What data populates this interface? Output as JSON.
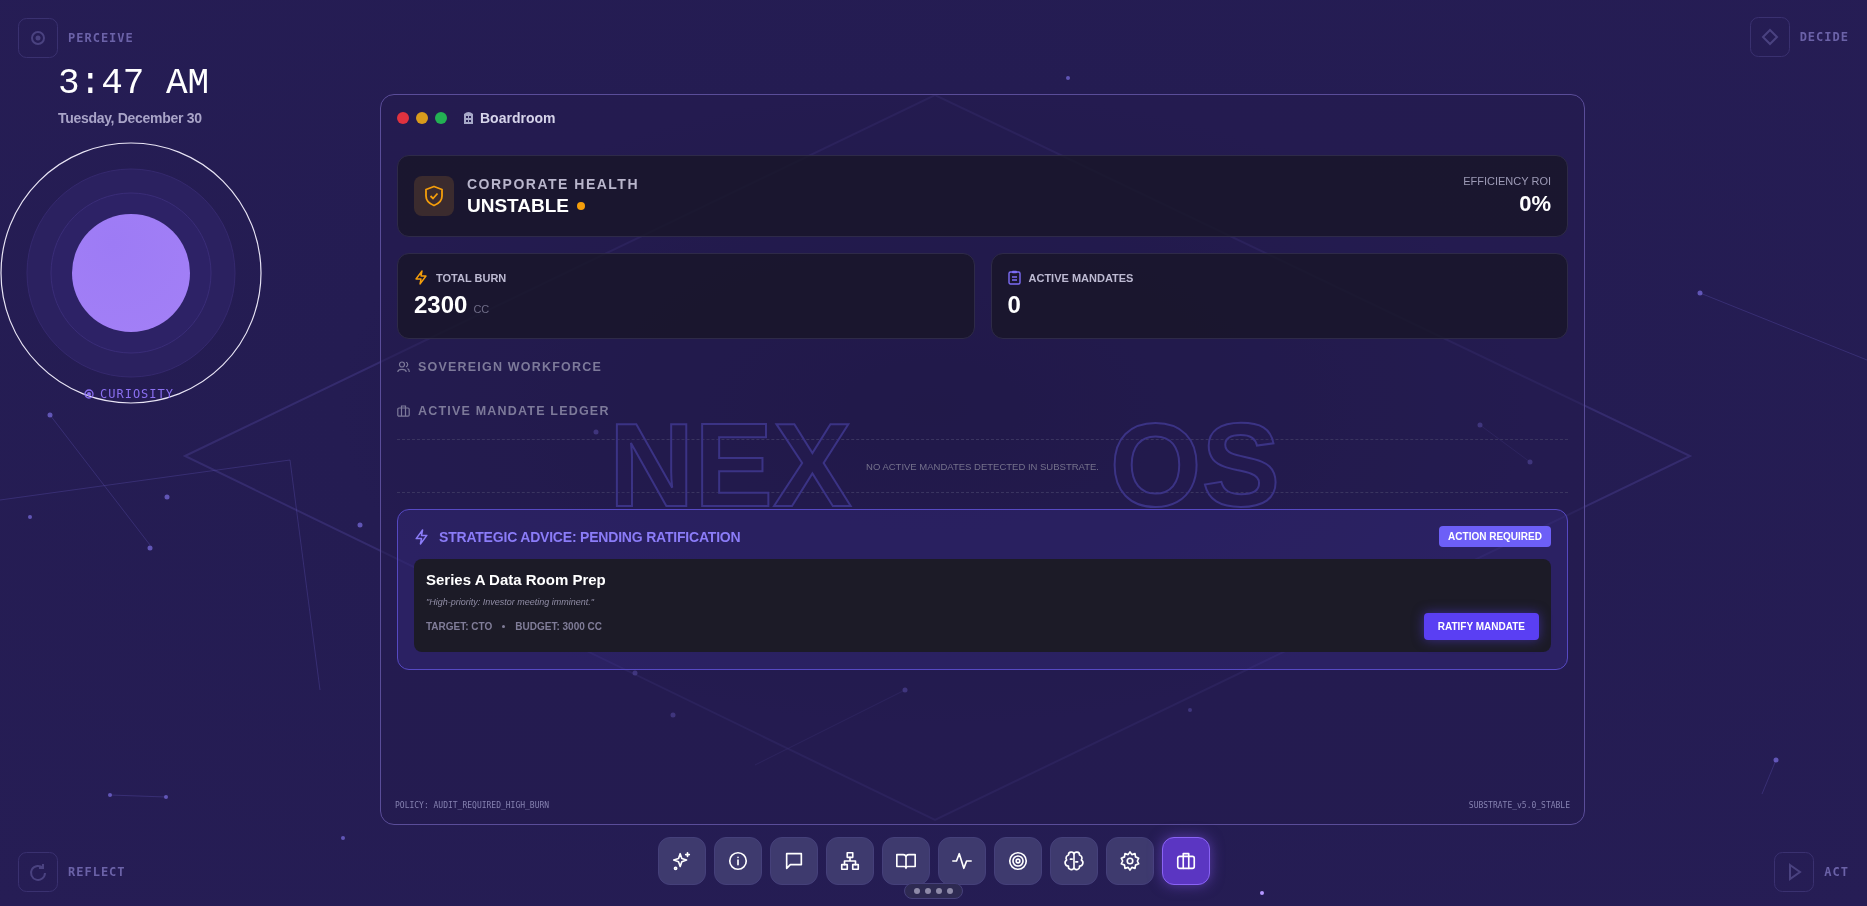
{
  "corners": [
    {
      "kind": "perceive",
      "label": "PERCEIVE"
    },
    {
      "kind": "decide",
      "label": "DECIDE"
    },
    {
      "kind": "reflect",
      "label": "REFLECT"
    },
    {
      "kind": "act",
      "label": "ACT"
    }
  ],
  "clock": {
    "time": "3:47 AM",
    "date": "Tuesday, December 30"
  },
  "mood": {
    "label": "CURIOSITY"
  },
  "window": {
    "title": "Boardroom"
  },
  "health": {
    "label": "CORPORATE HEALTH",
    "status": "UNSTABLE",
    "roi_label": "EFFICIENCY ROI",
    "roi_value": "0%"
  },
  "stats": [
    {
      "kind": "burn",
      "label": "TOTAL BURN",
      "value": "2300",
      "unit": "CC"
    },
    {
      "kind": "mandates",
      "label": "ACTIVE MANDATES",
      "value": "0"
    }
  ],
  "sections": [
    {
      "kind": "workforce",
      "label": "SOVEREIGN WORKFORCE"
    },
    {
      "kind": "ledger",
      "label": "ACTIVE MANDATE LEDGER"
    }
  ],
  "ledger_empty": "NO ACTIVE MANDATES DETECTED IN SUBSTRATE.",
  "brand_watermark": [
    "NEX",
    "OS"
  ],
  "advice": {
    "title": "STRATEGIC ADVICE: PENDING RATIFICATION",
    "badge": "ACTION REQUIRED",
    "card": {
      "title": "Series A Data Room Prep",
      "quote": "\"High-priority: Investor meeting imminent.\"",
      "target": "TARGET: CTO",
      "budget": "BUDGET: 3000 CC",
      "button": "RATIFY MANDATE"
    }
  },
  "footer": {
    "policy": "POLICY: AUDIT_REQUIRED_HIGH_BURN",
    "version": "SUBSTRATE_v5.0_STABLE"
  },
  "dock": [
    {
      "kind": "sparkles",
      "selected": false
    },
    {
      "kind": "info",
      "selected": false
    },
    {
      "kind": "chat",
      "selected": false
    },
    {
      "kind": "hierarchy",
      "selected": false
    },
    {
      "kind": "book",
      "selected": false
    },
    {
      "kind": "pulse",
      "selected": false
    },
    {
      "kind": "target",
      "selected": false
    },
    {
      "kind": "brain",
      "selected": false
    },
    {
      "kind": "gear",
      "selected": false
    },
    {
      "kind": "briefcase",
      "selected": true
    }
  ]
}
